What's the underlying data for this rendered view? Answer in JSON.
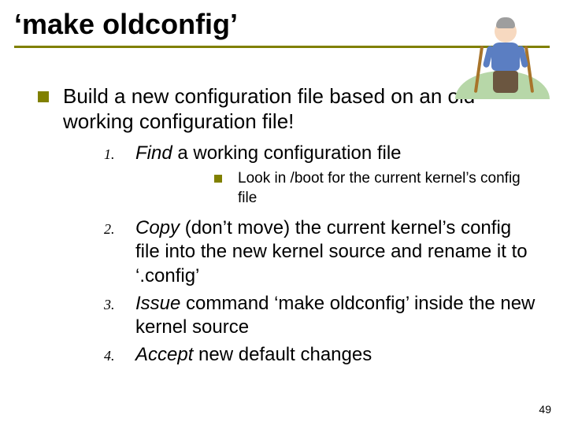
{
  "title": "‘make oldconfig’",
  "lead": "Build a new configuration file based on an old working configuration file!",
  "items": [
    {
      "num": "1.",
      "lead_italic": "Find",
      "rest": " a working configuration file",
      "sub": "Look in /boot for the current kernel’s config file"
    },
    {
      "num": "2.",
      "lead_italic": "Copy",
      "rest": " (don’t move) the current kernel’s config file into the new kernel source and rename it to ‘.config’"
    },
    {
      "num": "3.",
      "lead_italic": "Issue",
      "rest": " command ‘make oldconfig’ inside the new kernel source"
    },
    {
      "num": "4.",
      "lead_italic": "Accept",
      "rest": " new default changes"
    }
  ],
  "page_number": "49",
  "image_alt": "elderly-man-with-canes"
}
